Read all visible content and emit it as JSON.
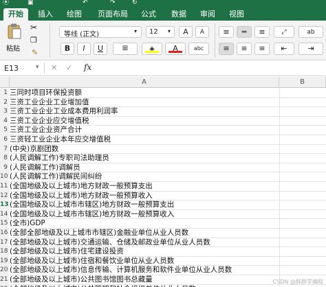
{
  "quick_access": {
    "icons": [
      "autosave-icon",
      "save-icon",
      "undo-icon",
      "redo-icon",
      "refresh-icon"
    ]
  },
  "tabs": [
    {
      "label": "开始",
      "active": true
    },
    {
      "label": "插入"
    },
    {
      "label": "绘图"
    },
    {
      "label": "页面布局"
    },
    {
      "label": "公式"
    },
    {
      "label": "数据"
    },
    {
      "label": "审阅"
    },
    {
      "label": "视图"
    }
  ],
  "ribbon": {
    "paste_label": "粘贴",
    "font_name": "等线 (正文)",
    "font_size": "12",
    "bold": "B",
    "italic": "I",
    "underline": "U",
    "font_grow": "A",
    "font_shrink": "A",
    "font_color_label": "A",
    "phonetic_label": "abc",
    "wrap_label": "ab"
  },
  "formula_bar": {
    "name_box": "E13",
    "fx": "fx",
    "value": ""
  },
  "columns": {
    "A": "A",
    "B": "B"
  },
  "selected_row": 13,
  "rows": [
    {
      "num": "1",
      "a": "三同时项目环保投资额"
    },
    {
      "num": "2",
      "a": "三资工业企业工业增加值"
    },
    {
      "num": "3",
      "a": "三资工业企业工业成本费用利润率"
    },
    {
      "num": "4",
      "a": "三资工业企业应交增值税"
    },
    {
      "num": "5",
      "a": "三资工业企业资产合计"
    },
    {
      "num": "6",
      "a": "三资轻工业企业本年应交增值税"
    },
    {
      "num": "7",
      "a": "(中央)京剧团数"
    },
    {
      "num": "8",
      "a": "(人民调解工作)专职司法助理员"
    },
    {
      "num": "9",
      "a": "(人民调解工作)调解员"
    },
    {
      "num": "10",
      "a": "(人民调解工作)调解民间纠纷"
    },
    {
      "num": "11",
      "a": "(全国地级及以上城市)地方财政一般预算支出"
    },
    {
      "num": "12",
      "a": "(全国地级及以上城市)地方财政一般预算收入"
    },
    {
      "num": "13",
      "a": "(全国地级及以上城市市辖区)地方财政一般预算支出"
    },
    {
      "num": "14",
      "a": "(全国地级及以上城市市辖区)地方财政一般预算收入"
    },
    {
      "num": "15",
      "a": "(全市)GDP"
    },
    {
      "num": "16",
      "a": "(全部全部地级及以上城市市辖区)金融业单位从业人员数"
    },
    {
      "num": "17",
      "a": "(全部地级及以上城市)交通运输、仓储及邮政业单位从业人员数"
    },
    {
      "num": "18",
      "a": "(全部地级及以上城市)住宅建设投资"
    },
    {
      "num": "19",
      "a": "(全部地级及以上城市)住宿和餐饮业单位从业人员数"
    },
    {
      "num": "20",
      "a": "(全部地级及以上城市)信息传输、计算机服务和软件业单位从业人员数"
    },
    {
      "num": "21",
      "a": "(全部地级及以上城市)公共图书馆图书总藏量"
    },
    {
      "num": "22",
      "a": "(全部地级及以上城市)公共管理和社会组织单位从业人员数"
    }
  ],
  "watermark": "CSDN @胖胖学编程",
  "colors": {
    "brand": "#1e7145",
    "highlight": "#ffff00",
    "font_red": "#e02020"
  }
}
